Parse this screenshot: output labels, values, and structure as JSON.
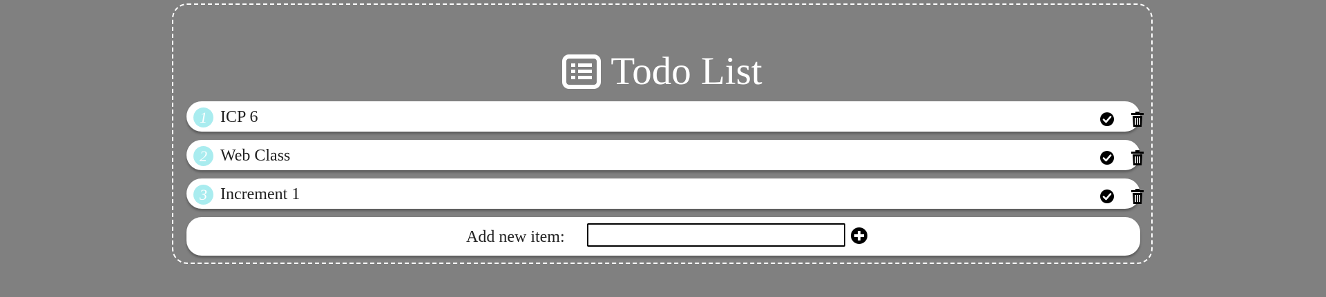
{
  "header": {
    "title": "Todo List",
    "icon": "list-alt-icon"
  },
  "items": [
    {
      "number": "1",
      "label": "ICP 6"
    },
    {
      "number": "2",
      "label": "Web Class"
    },
    {
      "number": "3",
      "label": "Increment 1"
    }
  ],
  "add_form": {
    "label": "Add new item:",
    "value": "",
    "placeholder": ""
  },
  "icons": {
    "complete": "check-circle-icon",
    "delete": "trash-icon",
    "add": "plus-circle-icon"
  },
  "colors": {
    "background": "#808080",
    "number_badge": "#a9ecef",
    "row": "#ffffff"
  }
}
